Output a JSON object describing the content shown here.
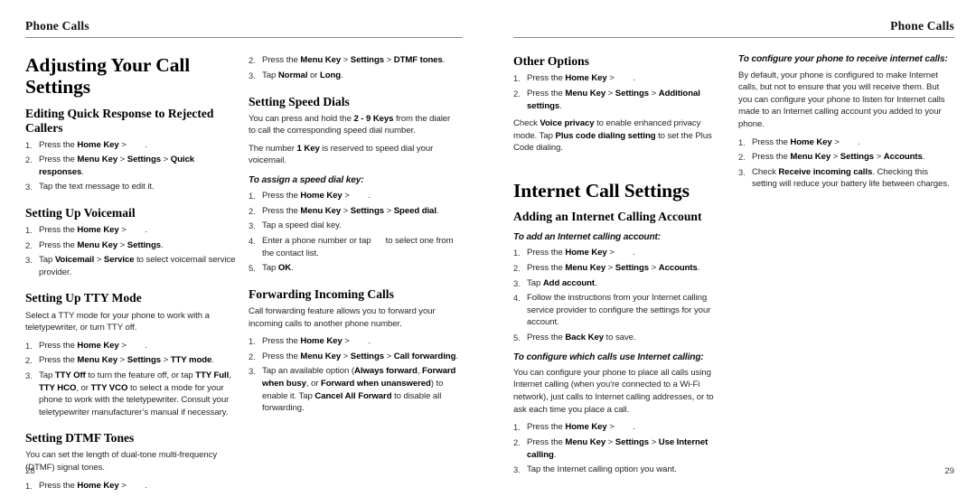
{
  "document": {
    "running_header": "Phone Calls",
    "left_page": {
      "folio": "28",
      "col1": {
        "h1": "Adjusting Your Call Settings",
        "s1": {
          "heading": "Editing Quick Response to Rejected Callers",
          "steps": [
            {
              "pre": "Press the ",
              "b1": "Home Key",
              "mid": " > ",
              "b2": "",
              "post": "."
            },
            {
              "pre": "Press the ",
              "b1": "Menu Key",
              "mid": " > ",
              "b2": "Settings",
              "mid2": " > ",
              "b3": "Quick responses",
              "post": "."
            },
            {
              "pre": "Tap the text message to edit it.",
              "b1": "",
              "post": ""
            }
          ]
        },
        "s2": {
          "heading": "Setting Up Voicemail",
          "steps": [
            {
              "pre": "Press the ",
              "b1": "Home Key",
              "mid": " > ",
              "post": "."
            },
            {
              "pre": "Press the ",
              "b1": "Menu Key",
              "mid": " > ",
              "b2": "Settings",
              "post": "."
            },
            {
              "pre": "Tap ",
              "b1": "Voicemail",
              "mid": " > ",
              "b2": "Service",
              "post": " to select voicemail service provider."
            }
          ]
        },
        "s3": {
          "heading": "Setting Up TTY Mode",
          "intro": "Select a TTY mode for your phone to work with a teletypewriter, or turn TTY off.",
          "steps": [
            {
              "pre": "Press the ",
              "b1": "Home Key",
              "mid": " > ",
              "post": "."
            },
            {
              "pre": "Press the ",
              "b1": "Menu Key",
              "mid": " > ",
              "b2": "Settings",
              "mid2": " > ",
              "b3": "TTY mode",
              "post": "."
            },
            {
              "pre": "Tap ",
              "b1": "TTY Off",
              "mid": " to turn the feature off, or tap ",
              "b2": "TTY Full",
              "mid2": ", ",
              "b3": "TTY HCO",
              "mid3": ", or ",
              "b4": "TTY VCO",
              "post": " to select a mode for your phone to work with the teletypewriter. Consult your teletypewriter manufacturer’s manual if necessary."
            }
          ]
        },
        "s4": {
          "heading": "Setting DTMF Tones",
          "intro": "You can set the length of dual-tone multi-frequency (DTMF) signal tones.",
          "steps": [
            {
              "pre": "Press the ",
              "b1": "Home Key",
              "mid": " > ",
              "post": "."
            }
          ]
        }
      },
      "col2": {
        "cont_steps": [
          {
            "n": "2.",
            "pre": "Press the ",
            "b1": "Menu Key",
            "mid": " > ",
            "b2": "Settings",
            "mid2": " > ",
            "b3": "DTMF tones",
            "post": "."
          },
          {
            "n": "3.",
            "pre": "Tap ",
            "b1": "Normal",
            "mid": " or ",
            "b2": "Long",
            "post": "."
          }
        ],
        "s5": {
          "heading": "Setting Speed Dials",
          "p1_pre": "You can press and hold the ",
          "p1_b": "2 - 9 Keys",
          "p1_post": " from the dialer to call the corresponding speed dial number.",
          "p2_pre": "The number ",
          "p2_b": "1 Key",
          "p2_post": " is reserved to speed dial your voicemail.",
          "sub": "To assign a speed dial key:",
          "steps": [
            {
              "pre": "Press the ",
              "b1": "Home Key",
              "mid": " > ",
              "post": "."
            },
            {
              "pre": "Press the ",
              "b1": "Menu Key",
              "mid": " > ",
              "b2": "Settings",
              "mid2": " > ",
              "b3": "Speed dial",
              "post": "."
            },
            {
              "pre": "Tap a speed dial key.",
              "post": ""
            },
            {
              "pre": "Enter a phone number or tap ",
              "mid": " to select one from the contact list.",
              "post": ""
            },
            {
              "pre": "Tap ",
              "b1": "OK",
              "post": "."
            }
          ]
        },
        "s6": {
          "heading": "Forwarding Incoming Calls",
          "intro": "Call forwarding feature allows you to forward your incoming calls to another phone number.",
          "steps": [
            {
              "pre": "Press the ",
              "b1": "Home Key",
              "mid": " > ",
              "post": "."
            },
            {
              "pre": "Press the ",
              "b1": "Menu Key",
              "mid": " > ",
              "b2": "Settings",
              "mid2": " > ",
              "b3": "Call forwarding",
              "post": "."
            },
            {
              "pre": "Tap an available option (",
              "b1": "Always forward",
              "mid": ", ",
              "b2": "Forward when busy",
              "mid2": ", or ",
              "b3": "Forward when unanswered",
              "mid3": ") to enable it. Tap ",
              "b4": "Cancel All Forward",
              "post": " to disable all forwarding."
            }
          ]
        }
      }
    },
    "right_page": {
      "folio": "29",
      "col1": {
        "s1": {
          "heading": "Other Options",
          "steps": [
            {
              "pre": "Press the ",
              "b1": "Home Key",
              "mid": " > ",
              "post": "."
            },
            {
              "pre": "Press the ",
              "b1": "Menu Key",
              "mid": " > ",
              "b2": "Settings",
              "mid2": " > ",
              "b3": "Additional settings",
              "post": "."
            }
          ],
          "note_pre": "Check ",
          "note_b1": "Voice privacy",
          "note_mid": " to enable enhanced privacy mode. Tap ",
          "note_b2": "Plus code dialing setting",
          "note_post": " to set the Plus Code dialing."
        },
        "h1": "Internet Call Settings",
        "s2": {
          "heading": "Adding an Internet Calling Account",
          "sub": "To add an Internet calling account:",
          "steps": [
            {
              "pre": "Press the ",
              "b1": "Home Key",
              "mid": " > ",
              "post": "."
            },
            {
              "pre": "Press the ",
              "b1": "Menu Key",
              "mid": " > ",
              "b2": "Settings",
              "mid2": " > ",
              "b3": "Accounts",
              "post": "."
            },
            {
              "pre": "Tap ",
              "b1": "Add account",
              "post": "."
            },
            {
              "pre": "Follow the instructions from your Internet calling service provider to configure the settings for your account.",
              "post": ""
            },
            {
              "pre": "Press the ",
              "b1": "Back Key",
              "post": " to save."
            }
          ]
        },
        "s3": {
          "sub": "To configure which calls use Internet calling:",
          "intro": "You can configure your phone to place all calls using Internet calling (when you're connected to a Wi-Fi network), just calls to Internet calling addresses, or to ask each time you place a call.",
          "steps": [
            {
              "pre": "Press the ",
              "b1": "Home Key",
              "mid": " > ",
              "post": "."
            },
            {
              "pre": "Press the ",
              "b1": "Menu Key",
              "mid": " > ",
              "b2": "Settings",
              "mid2": " > ",
              "b3": "Use Internet calling",
              "post": "."
            },
            {
              "pre": "Tap the Internet calling option you want.",
              "post": ""
            }
          ]
        }
      },
      "col2": {
        "s4": {
          "sub": "To configure your phone to receive internet calls:",
          "intro": "By default, your phone is configured to make Internet calls, but not to ensure that you will receive them. But you can configure your phone to listen for Internet calls made to an Internet calling account you added to your phone.",
          "steps": [
            {
              "pre": "Press the ",
              "b1": "Home Key",
              "mid": " > ",
              "post": "."
            },
            {
              "pre": "Press the ",
              "b1": "Menu Key",
              "mid": " > ",
              "b2": "Settings",
              "mid2": " > ",
              "b3": "Accounts",
              "post": "."
            },
            {
              "pre": "Check ",
              "b1": "Receive incoming calls",
              "post": ". Checking this setting will reduce your battery life between charges."
            }
          ]
        }
      }
    }
  }
}
